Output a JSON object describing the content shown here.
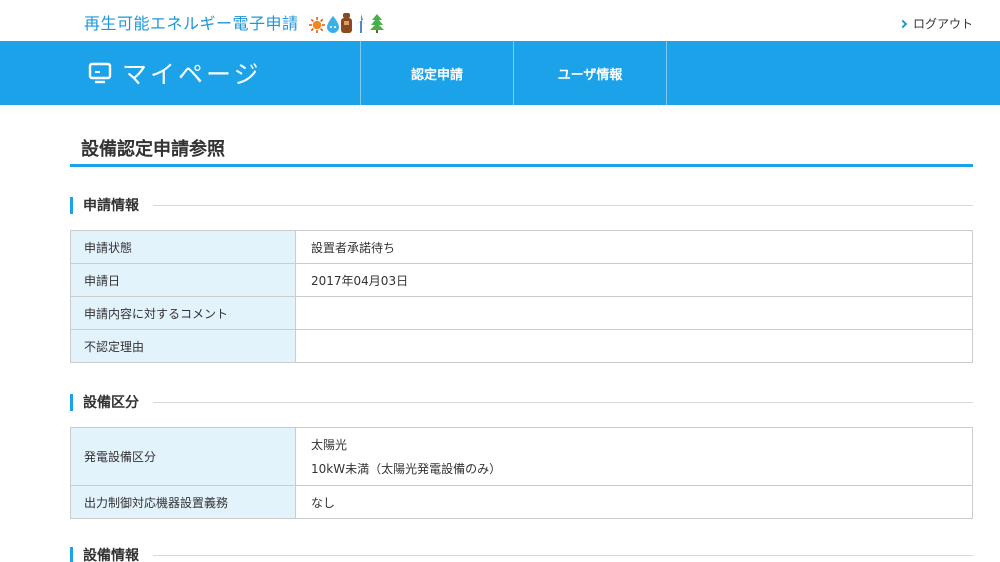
{
  "header": {
    "brand": "再生可能エネルギー電子申請",
    "logout": "ログアウト",
    "icons": [
      "sun-icon",
      "water-drop-icon",
      "bear-icon",
      "wind-turbine-icon",
      "tree-icon"
    ]
  },
  "nav": {
    "mypage": "マイページ",
    "items": [
      "認定申請",
      "ユーザ情報"
    ]
  },
  "page": {
    "title": "設備認定申請参照"
  },
  "sections": {
    "application": {
      "heading": "申請情報",
      "rows": [
        {
          "label": "申請状態",
          "value": "設置者承諾待ち"
        },
        {
          "label": "申請日",
          "value": "2017年04月03日"
        },
        {
          "label": "申請内容に対するコメント",
          "value": ""
        },
        {
          "label": "不認定理由",
          "value": ""
        }
      ]
    },
    "category": {
      "heading": "設備区分",
      "rows": [
        {
          "label": "発電設備区分",
          "value_lines": [
            "太陽光",
            "10kW未満（太陽光発電設備のみ）"
          ]
        },
        {
          "label": "出力制御対応機器設置義務",
          "value": "なし"
        }
      ]
    },
    "equipment": {
      "heading": "設備情報"
    }
  },
  "colors": {
    "accent": "#1ca2e8",
    "brand_text": "#1f97d9",
    "key_cell_bg": "#e3f3fc",
    "border": "#cccccc"
  }
}
